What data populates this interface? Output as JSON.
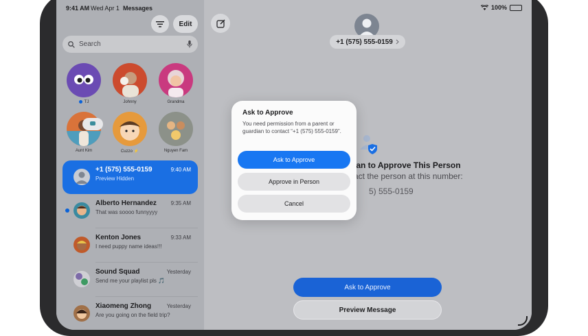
{
  "status_bar": {
    "time": "9:41 AM",
    "date": "Wed Apr 1",
    "app": "Messages",
    "battery": "100%"
  },
  "sidebar": {
    "edit_label": "Edit",
    "search_placeholder": "Search",
    "pinned": [
      {
        "name": "TJ",
        "color": "#6b4bb3",
        "unread": true
      },
      {
        "name": "Johnny",
        "color": "#6f8f9e"
      },
      {
        "name": "Grandma",
        "color": "#c93a7f"
      },
      {
        "name": "Aunt Kim",
        "color": "#d9733a"
      },
      {
        "name": "Cuzzo ⚡",
        "color": "#e69a3c"
      },
      {
        "name": "Nguyen Fam",
        "color": "#8c9189"
      }
    ],
    "conversations": [
      {
        "name": "+1 (575) 555-0159",
        "time": "9:40 AM",
        "preview": "Preview Hidden",
        "selected": true
      },
      {
        "name": "Alberto Hernandez",
        "time": "9:35 AM",
        "preview": "That was soooo funnyyyy",
        "unread": true,
        "color": "#3a8aa0"
      },
      {
        "name": "Kenton Jones",
        "time": "9:33 AM",
        "preview": "I need puppy name ideas!!!",
        "color": "#c05a2a"
      },
      {
        "name": "Sound Squad",
        "time": "Yesterday",
        "preview": "Send me your playlist pls 🎵",
        "color": "#7c6aa8"
      },
      {
        "name": "Xiaomeng Zhong",
        "time": "Yesterday",
        "preview": "Are you going on the field trip?",
        "color": "#a07048"
      }
    ]
  },
  "detail": {
    "contact_number": "+1 (575) 555-0159",
    "info_title": "ian to Approve This Person",
    "info_subtitle": "ntact the person at this number:",
    "info_number": "5) 555-0159",
    "ask_button": "Ask to Approve",
    "preview_button": "Preview Message"
  },
  "alert": {
    "title": "Ask to Approve",
    "message": "You need permission from a parent or guardian to contact “+1 (575) 555-0159”.",
    "primary": "Ask to Approve",
    "secondary": "Approve in Person",
    "cancel": "Cancel"
  }
}
